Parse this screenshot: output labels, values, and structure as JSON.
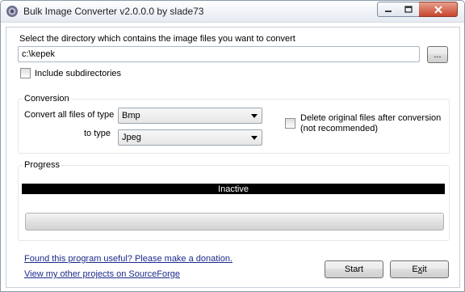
{
  "window": {
    "title": "Bulk Image Converter v2.0.0.0 by slade73"
  },
  "directory": {
    "prompt": "Select the directory which contains the image files you want to convert",
    "path": "c:\\kepek",
    "browse_label": "...",
    "include_subdirs_label": "Include subdirectories",
    "include_subdirs_checked": false
  },
  "conversion": {
    "group_title": "Conversion",
    "from_label": "Convert all files of type",
    "from_value": "Bmp",
    "to_label": "to type",
    "to_value": "Jpeg",
    "delete_label_line1": "Delete original files after conversion",
    "delete_label_line2": "(not recommended)",
    "delete_checked": false
  },
  "progress": {
    "group_title": "Progress",
    "status": "Inactive",
    "value": 0
  },
  "footer": {
    "donation_link": "Found this program useful?  Please make a donation.",
    "projects_link": "View my other projects on SourceForge",
    "start_label": "Start",
    "exit_label_prefix": "E",
    "exit_label_accel": "x",
    "exit_label_suffix": "it"
  }
}
